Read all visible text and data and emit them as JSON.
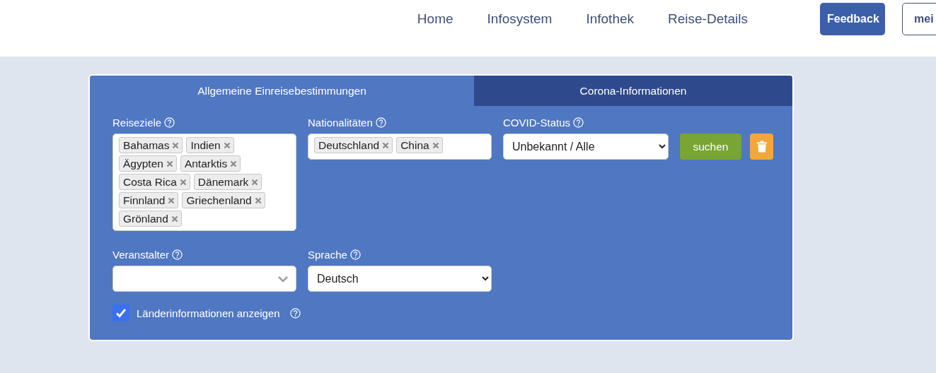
{
  "nav": {
    "links": [
      {
        "label": "Home"
      },
      {
        "label": "Infosystem"
      },
      {
        "label": "Infothek"
      },
      {
        "label": "Reise-Details"
      }
    ],
    "buttons": [
      {
        "label": "Feedback",
        "kind": "primary"
      },
      {
        "label": "mei",
        "kind": "outline"
      }
    ]
  },
  "tabs": [
    {
      "label": "Allgemeine Einreisebestimmungen",
      "selected": true
    },
    {
      "label": "Corona-Informationen",
      "selected": false
    }
  ],
  "fields": [
    {
      "kind": "tags",
      "label": "Reiseziele",
      "tags": [
        "Bahamas",
        "Indien",
        "Ägypten",
        "Antarktis",
        "Costa Rica",
        "Dänemark",
        "Finnland",
        "Griechenland",
        "Grönland"
      ]
    },
    {
      "kind": "tags",
      "label": "Nationalitäten",
      "tags": [
        "Deutschland",
        "China"
      ]
    },
    {
      "kind": "select",
      "label": "COVID-Status",
      "value": "Unbekannt / Alle"
    },
    {
      "kind": "combo",
      "label": "Veranstalter"
    },
    {
      "kind": "select",
      "label": "Sprache",
      "value": "Deutsch"
    }
  ],
  "search_button": "suchen",
  "checkbox": {
    "label": "Länderinformationen anzeigen",
    "checked": true
  }
}
